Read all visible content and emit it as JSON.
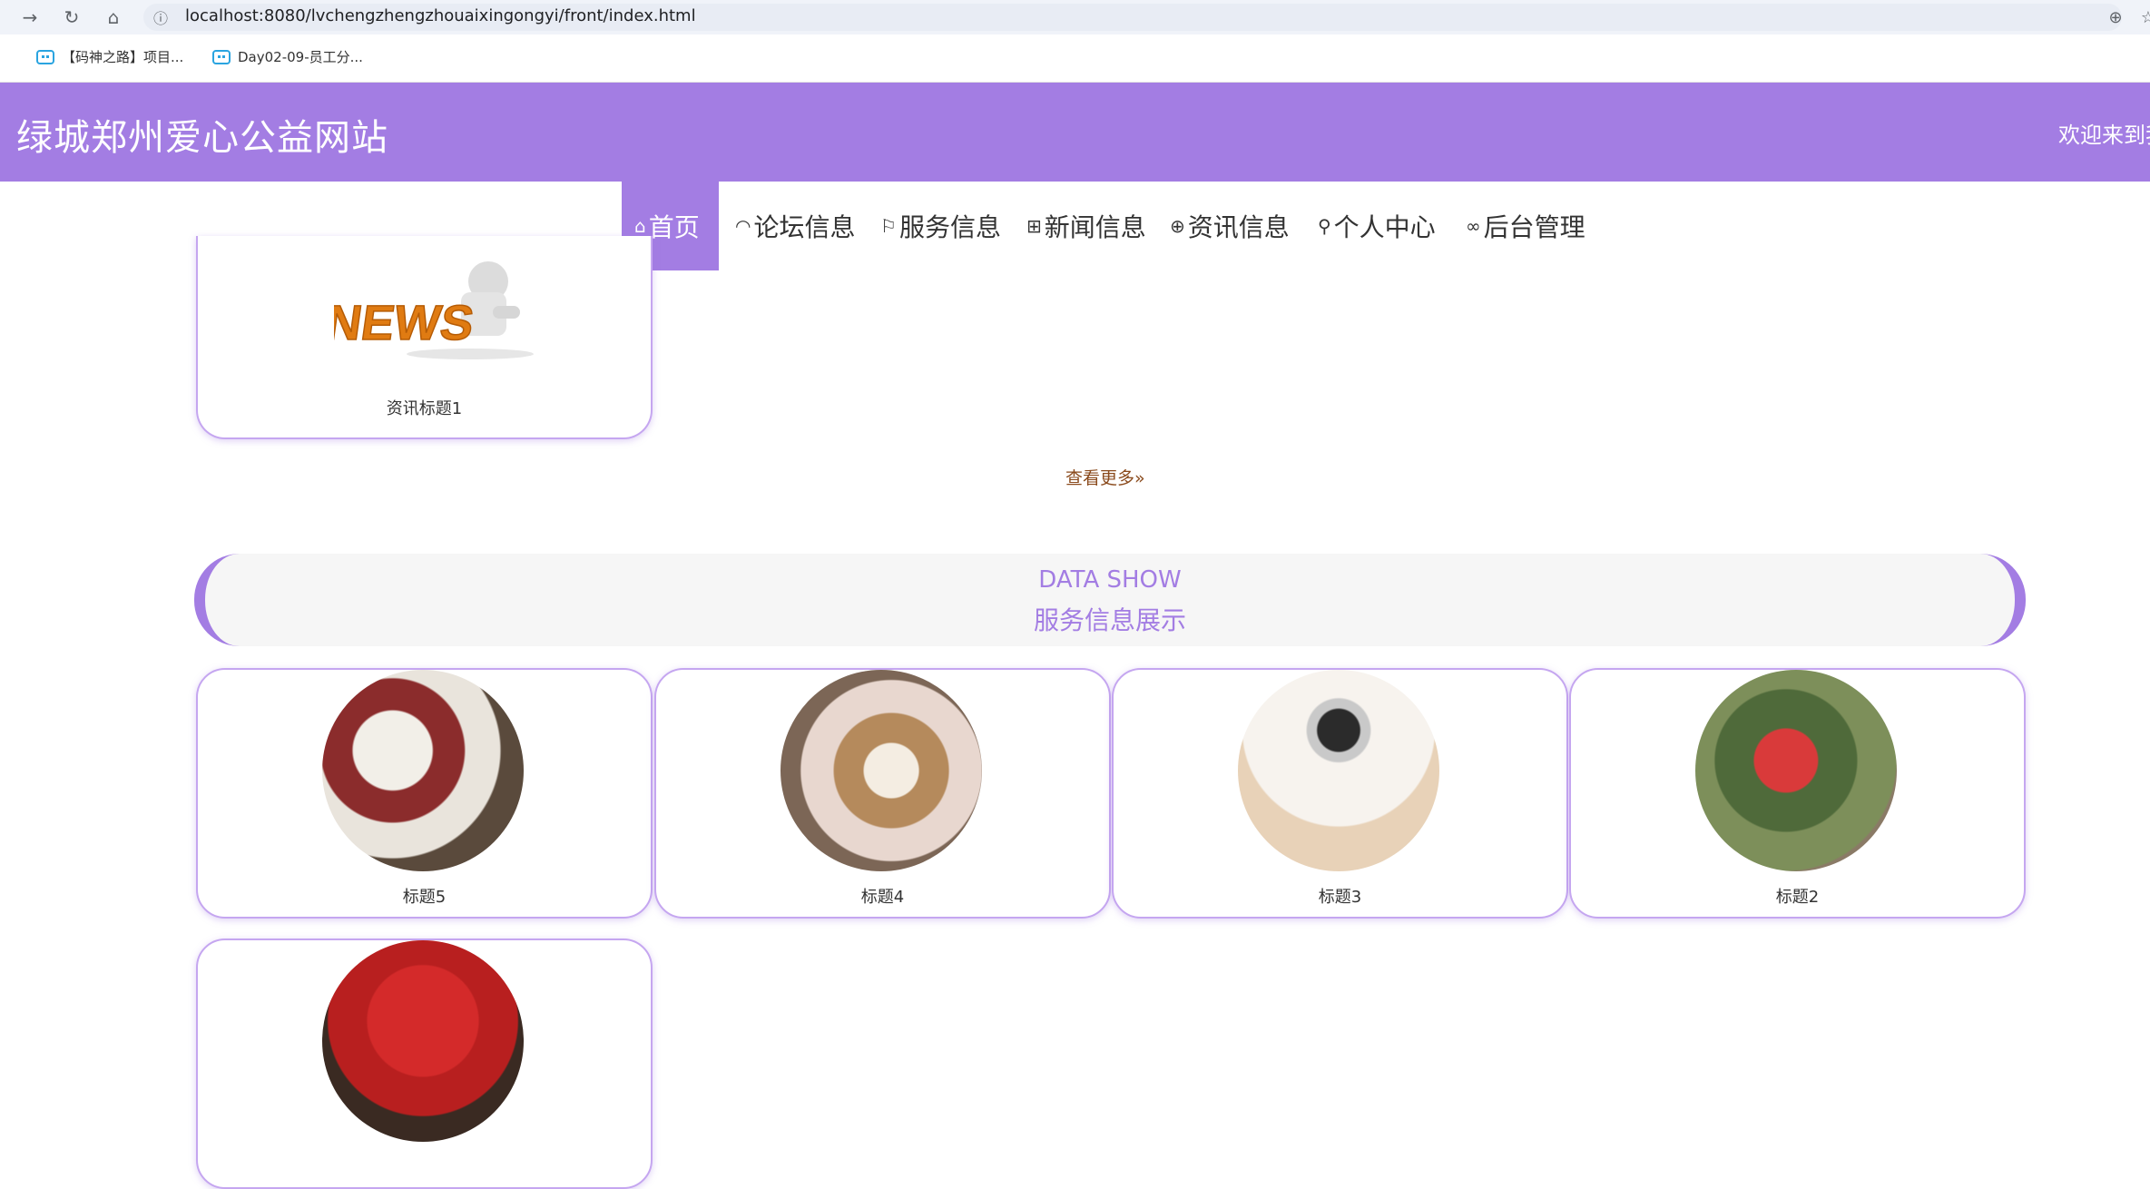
{
  "browser": {
    "url": "localhost:8080/lvchengzhengzhouaixingongyi/front/index.html",
    "bookmarks": [
      "【码神之路】项目...",
      "Day02-09-员工分..."
    ]
  },
  "header": {
    "site_title": "绿城郑州爱心公益网站",
    "welcome": "欢迎来到我"
  },
  "nav": {
    "items": [
      {
        "label": "首页",
        "icon": "home-icon"
      },
      {
        "label": "论坛信息",
        "icon": "dashboard-icon"
      },
      {
        "label": "服务信息",
        "icon": "flag-icon"
      },
      {
        "label": "新闻信息",
        "icon": "gift-icon"
      },
      {
        "label": "资讯信息",
        "icon": "globe-icon"
      },
      {
        "label": "个人中心",
        "icon": "user-icon"
      },
      {
        "label": "后台管理",
        "icon": "link-icon"
      }
    ]
  },
  "news": {
    "card_title": "资讯标题1",
    "image_text": "NEWS",
    "more": "查看更多»"
  },
  "service_section": {
    "title_en": "DATA SHOW",
    "title_cn": "服务信息展示",
    "cards": [
      {
        "title": "标题5"
      },
      {
        "title": "标题4"
      },
      {
        "title": "标题3"
      },
      {
        "title": "标题2"
      },
      {
        "title": ""
      }
    ]
  },
  "colors": {
    "brand": "#a37de3",
    "more_link": "#8a4a1c"
  }
}
